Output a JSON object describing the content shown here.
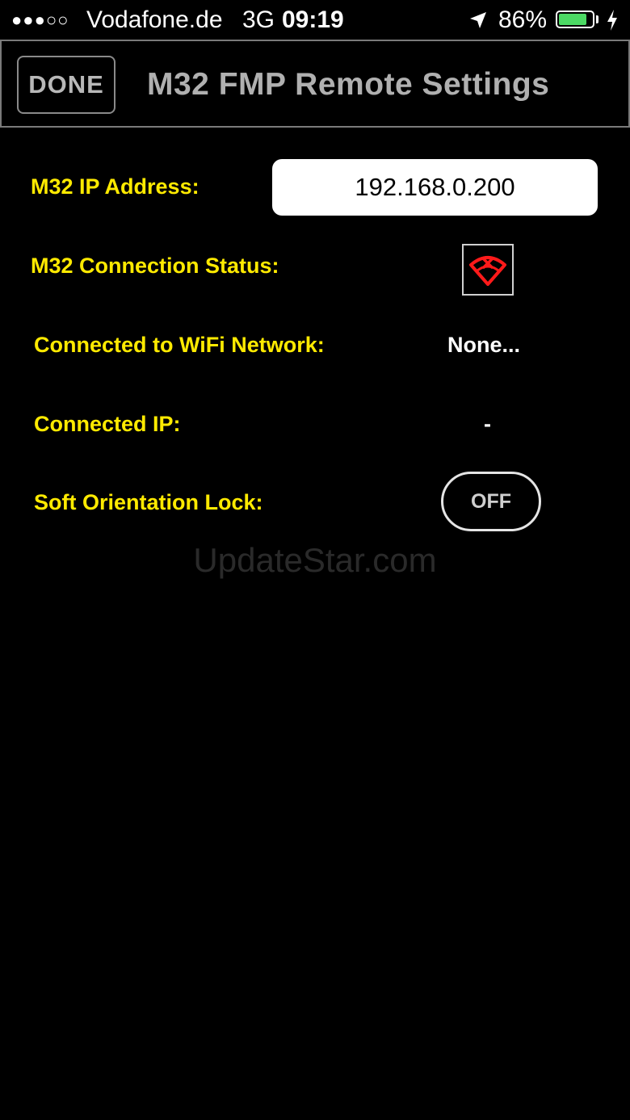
{
  "status_bar": {
    "signal": "●●●○○",
    "carrier": "Vodafone.de",
    "network": "3G",
    "time": "09:19",
    "battery_percent": "86%",
    "battery_level": 0.86,
    "battery_color": "#4cd964"
  },
  "header": {
    "done_label": "DONE",
    "title": "M32 FMP Remote Settings"
  },
  "settings": {
    "ip_address_label": "M32 IP Address:",
    "ip_address_value": "192.168.0.200",
    "connection_status_label": "M32 Connection Status:",
    "connection_status_icon": "wifi-disconnected-icon",
    "wifi_network_label": "Connected to WiFi Network:",
    "wifi_network_value": "None...",
    "connected_ip_label": "Connected IP:",
    "connected_ip_value": "-",
    "orientation_lock_label": "Soft Orientation Lock:",
    "orientation_lock_value": "OFF"
  },
  "colors": {
    "label_yellow": "#ffea00",
    "status_red": "#ff1a1a"
  },
  "watermark": "UpdateStar.com"
}
